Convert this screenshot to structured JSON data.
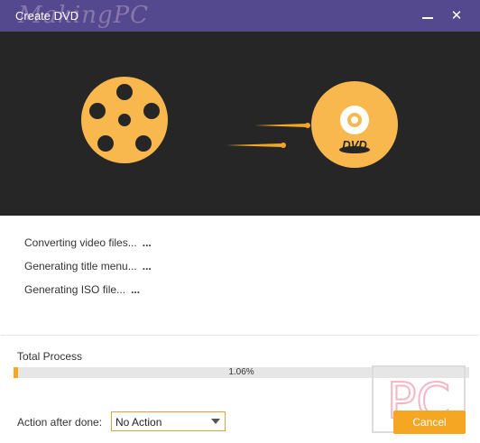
{
  "window": {
    "title": "Create DVD",
    "watermark_text": "MakingPC"
  },
  "banner": {
    "dvd_label": "DVD"
  },
  "steps": [
    {
      "label": "Converting video files...",
      "dots": "..."
    },
    {
      "label": "Generating title menu...",
      "dots": "..."
    },
    {
      "label": "Generating ISO file...",
      "dots": "..."
    }
  ],
  "progress": {
    "label": "Total Process",
    "value_percent": 1.06,
    "value_text": "1.06%"
  },
  "footer": {
    "action_label": "Action after done:",
    "action_selected": "No Action",
    "cancel_label": "Cancel"
  },
  "logo": {
    "text": "PC"
  },
  "colors": {
    "titlebar": "#54488e",
    "banner": "#262626",
    "accent": "#f5a623",
    "progress_track": "#e6e6e6"
  }
}
